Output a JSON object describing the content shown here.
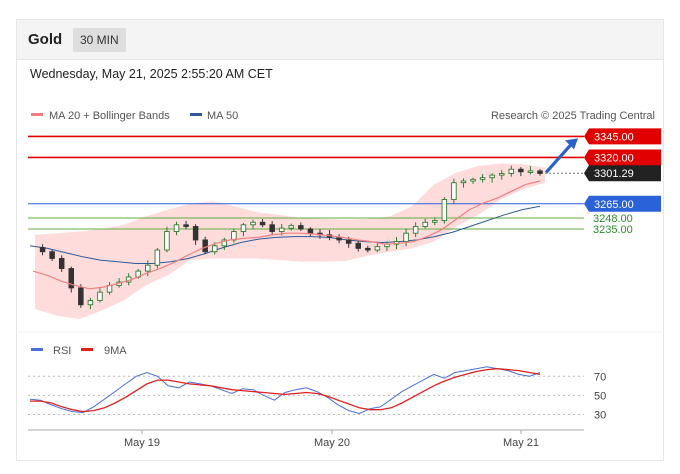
{
  "header": {
    "title": "Gold",
    "timeframe": "30 MIN"
  },
  "timestamp": "Wednesday, May 21, 2025 2:55:20 AM CET",
  "legend": {
    "ma20": "MA 20 + Bollinger Bands",
    "ma50": "MA 50"
  },
  "credit": "Research © 2025 Trading Central",
  "rsi_legend": {
    "rsi": "RSI",
    "ma9": "9MA"
  },
  "colors": {
    "resistance": "#e00000",
    "support_blue": "#2a62d9",
    "support_green": "#5fae3e",
    "ma20": "#f08080",
    "ma50": "#2e5a9a",
    "band": "#ffd6d6",
    "candle_up": "#2f7a2f",
    "candle_down": "#333333",
    "arrow": "#2a62c9",
    "rsi": "#4a6fd6",
    "rsi_ma": "#e02020",
    "last_price_bg": "#222222"
  },
  "chart_data": [
    {
      "type": "candlestick",
      "ylim": [
        3115,
        3355
      ],
      "x_ticks": [
        "May 19",
        "May 20",
        "May 21"
      ],
      "levels": [
        {
          "value": 3345.0,
          "label": "3345.00",
          "kind": "resistance"
        },
        {
          "value": 3320.0,
          "label": "3320.00",
          "kind": "resistance"
        },
        {
          "value": 3301.29,
          "label": "3301.29",
          "kind": "last"
        },
        {
          "value": 3265.0,
          "label": "3265.00",
          "kind": "support-blue"
        },
        {
          "value": 3248.0,
          "label": "3248.00",
          "kind": "support-green"
        },
        {
          "value": 3235.0,
          "label": "3235.00",
          "kind": "support-green"
        }
      ],
      "price_path": [
        3213,
        3208,
        3200,
        3188,
        3165,
        3145,
        3150,
        3160,
        3168,
        3172,
        3178,
        3185,
        3192,
        3210,
        3232,
        3240,
        3238,
        3222,
        3208,
        3215,
        3222,
        3232,
        3240,
        3243,
        3240,
        3232,
        3236,
        3239,
        3235,
        3230,
        3228,
        3225,
        3222,
        3218,
        3212,
        3210,
        3214,
        3217,
        3220,
        3230,
        3238,
        3243,
        3245,
        3270,
        3290,
        3292,
        3294,
        3296,
        3299,
        3301,
        3306,
        3303,
        3304,
        3301
      ],
      "ma20": [
        3185,
        3180,
        3173,
        3168,
        3164,
        3166,
        3170,
        3175,
        3182,
        3188,
        3195,
        3204,
        3212,
        3218,
        3222,
        3224,
        3225,
        3228,
        3230,
        3230,
        3229,
        3227,
        3225,
        3222,
        3220,
        3217,
        3218,
        3220,
        3226,
        3234,
        3246,
        3258,
        3266,
        3272,
        3280,
        3288,
        3292
      ],
      "ma50": [
        3215,
        3212,
        3207,
        3202,
        3198,
        3196,
        3194,
        3194,
        3196,
        3200,
        3206,
        3213,
        3219,
        3223,
        3225,
        3226,
        3226,
        3225,
        3222,
        3220,
        3219,
        3220,
        3222,
        3226,
        3231,
        3238,
        3245,
        3252,
        3258,
        3262
      ],
      "bollinger_upper": [
        3228,
        3230,
        3232,
        3235,
        3240,
        3250,
        3258,
        3265,
        3268,
        3262,
        3255,
        3252,
        3248,
        3247,
        3246,
        3247,
        3250,
        3262,
        3288,
        3302,
        3310,
        3313,
        3312,
        3308
      ],
      "bollinger_lower": [
        3140,
        3132,
        3128,
        3138,
        3150,
        3168,
        3180,
        3198,
        3200,
        3200,
        3200,
        3198,
        3196,
        3196,
        3197,
        3203,
        3208,
        3212,
        3220,
        3238,
        3252,
        3270,
        3282,
        3290
      ],
      "forecast_target": 3345
    },
    {
      "type": "line",
      "title": "RSI",
      "ylim": [
        20,
        85
      ],
      "y_ticks": [
        70,
        50,
        30
      ],
      "series": [
        {
          "name": "RSI",
          "values": [
            46,
            45,
            40,
            36,
            33,
            32,
            38,
            46,
            54,
            62,
            70,
            74,
            70,
            60,
            58,
            64,
            62,
            60,
            56,
            52,
            57,
            56,
            50,
            45,
            53,
            56,
            58,
            54,
            48,
            40,
            34,
            31,
            36,
            38,
            46,
            54,
            60,
            66,
            72,
            68,
            74,
            76,
            78,
            80,
            78,
            76,
            72,
            70,
            74
          ]
        },
        {
          "name": "9MA",
          "values": [
            44,
            44,
            42,
            38,
            35,
            33,
            34,
            37,
            42,
            48,
            55,
            62,
            66,
            66,
            64,
            62,
            61,
            60,
            58,
            56,
            55,
            54,
            53,
            52,
            51,
            52,
            53,
            52,
            49,
            45,
            41,
            37,
            35,
            35,
            37,
            42,
            48,
            54,
            60,
            65,
            69,
            72,
            75,
            77,
            78,
            77,
            76,
            74,
            72
          ]
        }
      ]
    }
  ]
}
